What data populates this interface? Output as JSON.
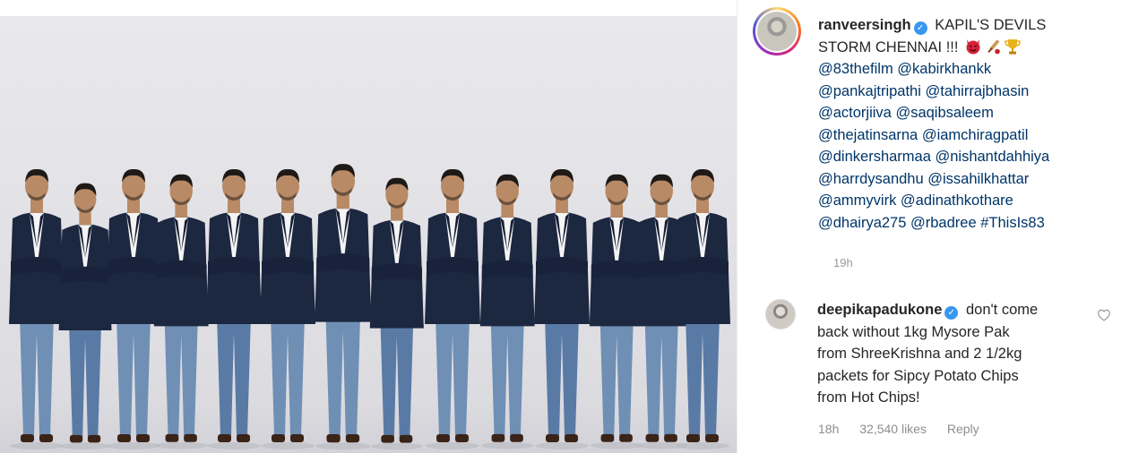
{
  "photo": {
    "people_count": 14,
    "colors": {
      "background": "#e4e4e8",
      "blazer": "#1c2740",
      "jeans": "#6f8fb5",
      "shirt": "#f4f4f4",
      "skin": "#b98a66",
      "hair": "#1e1a17"
    }
  },
  "post": {
    "username": "ranveersingh",
    "caption_line1": "KAPIL'S DEVILS",
    "caption_line2": "STORM CHENNAI !!!",
    "emojis": [
      "devil-emoji",
      "cricket-emoji",
      "trophy-emoji"
    ],
    "mentions_lines": [
      [
        "@83thefilm",
        "@kabirkhankk"
      ],
      [
        "@pankajtripathi",
        "@tahirrajbhasin"
      ],
      [
        "@actorjiiva",
        "@saqibsaleem"
      ],
      [
        "@thejatinsarna",
        "@iamchiragpatil"
      ],
      [
        "@dinkersharmaa",
        "@nishantdahhiya"
      ],
      [
        "@harrdysandhu",
        "@issahilkhattar"
      ],
      [
        "@ammyvirk",
        "@adinathkothare"
      ],
      [
        "@dhairya275",
        "@rbadree",
        "#ThisIs83"
      ]
    ],
    "time": "19h"
  },
  "comment": {
    "username": "deepikapadukone",
    "text_line1": "don't come",
    "text_line2": "back without 1kg Mysore Pak",
    "text_line3": "from ShreeKrishna and 2 1/2kg",
    "text_line4": "packets for Sipcy Potato Chips",
    "text_line5": "from Hot Chips!",
    "time": "18h",
    "likes": "32,540 likes",
    "reply_label": "Reply"
  },
  "colors": {
    "link": "#003569",
    "verified": "#3897f0",
    "muted": "#8e8e8e",
    "text": "#262626"
  }
}
